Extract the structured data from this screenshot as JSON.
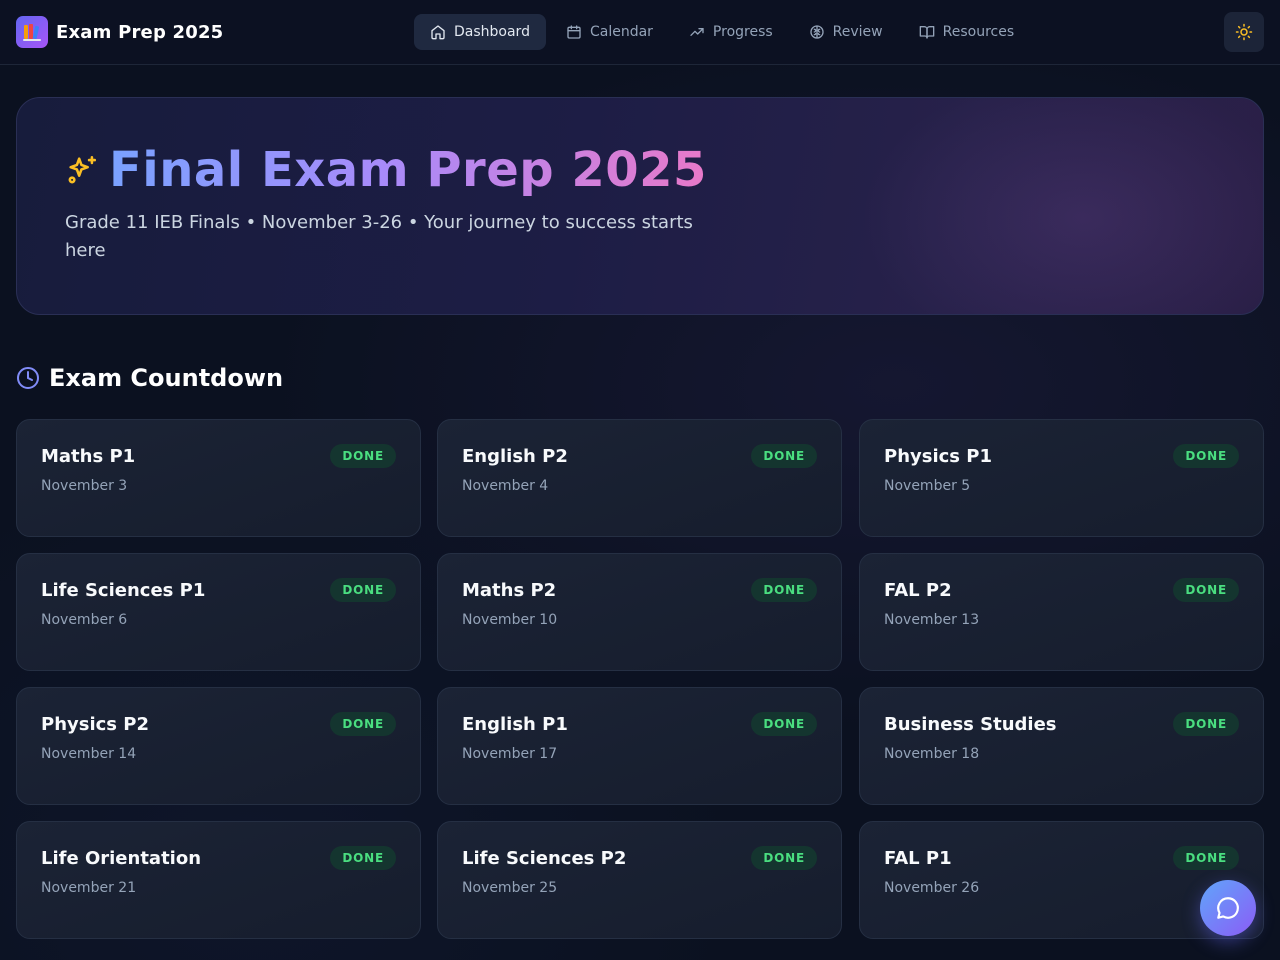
{
  "brand": {
    "title": "Exam Prep 2025",
    "logo_icon": "books-emoji"
  },
  "nav": [
    {
      "label": "Dashboard",
      "icon": "home-icon",
      "active": true
    },
    {
      "label": "Calendar",
      "icon": "calendar-icon",
      "active": false
    },
    {
      "label": "Progress",
      "icon": "trending-up-icon",
      "active": false
    },
    {
      "label": "Review",
      "icon": "brain-icon",
      "active": false
    },
    {
      "label": "Resources",
      "icon": "book-open-icon",
      "active": false
    }
  ],
  "theme_toggle": {
    "icon": "sun-icon"
  },
  "hero": {
    "title": "Final Exam Prep 2025",
    "subtitle": "Grade 11 IEB Finals • November 3-26 • Your journey to success starts here"
  },
  "countdown": {
    "heading": "Exam Countdown",
    "exams": [
      {
        "name": "Maths P1",
        "date": "November 3",
        "status": "DONE"
      },
      {
        "name": "English P2",
        "date": "November 4",
        "status": "DONE"
      },
      {
        "name": "Physics P1",
        "date": "November 5",
        "status": "DONE"
      },
      {
        "name": "Life Sciences P1",
        "date": "November 6",
        "status": "DONE"
      },
      {
        "name": "Maths P2",
        "date": "November 10",
        "status": "DONE"
      },
      {
        "name": "FAL P2",
        "date": "November 13",
        "status": "DONE"
      },
      {
        "name": "Physics P2",
        "date": "November 14",
        "status": "DONE"
      },
      {
        "name": "English P1",
        "date": "November 17",
        "status": "DONE"
      },
      {
        "name": "Business Studies",
        "date": "November 18",
        "status": "DONE"
      },
      {
        "name": "Life Orientation",
        "date": "November 21",
        "status": "DONE"
      },
      {
        "name": "Life Sciences P2",
        "date": "November 25",
        "status": "DONE"
      },
      {
        "name": "FAL P1",
        "date": "November 26",
        "status": "DONE"
      }
    ]
  },
  "chat_button": {
    "icon": "chat-bubble-icon"
  },
  "colors": {
    "accent": "#6366f1",
    "done_text": "#4ade80",
    "done_bg": "#14352f",
    "sparkle": "#fbbf24"
  }
}
